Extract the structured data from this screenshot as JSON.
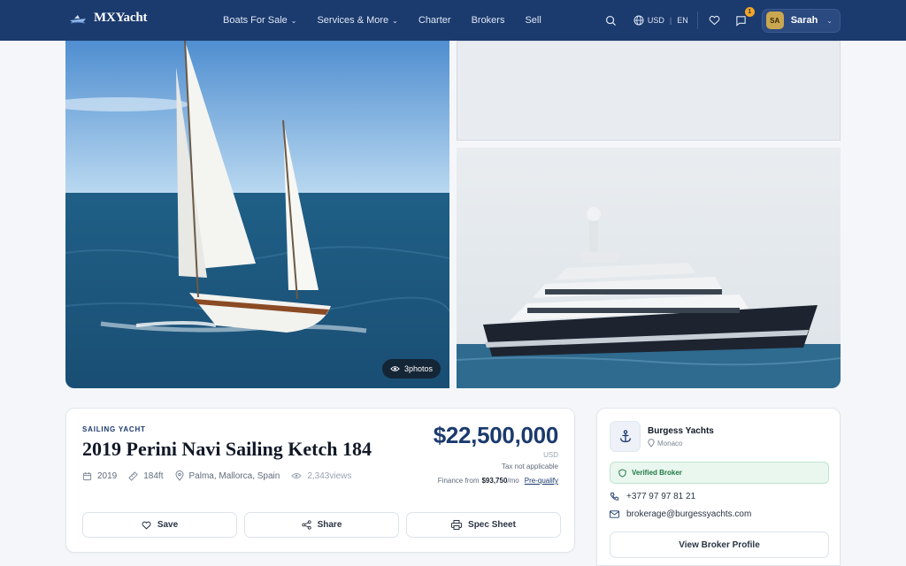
{
  "nav": {
    "logo_text": "MXYacht",
    "menu": [
      {
        "label": "Boats For Sale",
        "has_dropdown": true
      },
      {
        "label": "Services & More",
        "has_dropdown": true
      },
      {
        "label": "Charter",
        "has_dropdown": false
      },
      {
        "label": "Brokers",
        "has_dropdown": false
      },
      {
        "label": "Sell",
        "has_dropdown": false
      }
    ],
    "currency": "USD",
    "language": "EN",
    "messages_badge": "1",
    "user": {
      "initials": "SA",
      "name": "Sarah"
    },
    "icons": [
      "search-icon",
      "globe-icon",
      "heart-icon",
      "chat-icon",
      "chevron-down-icon"
    ],
    "colors": {
      "nav_bg": "#1b3a6d",
      "badge": "#f5a623",
      "avatar": "#c9a64f"
    }
  },
  "gallery": {
    "photo_count": "3photos"
  },
  "listing": {
    "category": "SAILING YACHT",
    "title": "2019 Perini Navi Sailing Ketch 184",
    "year": "2019",
    "length": "184ft",
    "location": "Palma, Mallorca, Spain",
    "views": "2,343views",
    "price": "$22,500,000",
    "currency": "USD",
    "tax_note": "Tax not applicable",
    "finance_prefix": "Finance from",
    "finance_amount": "$93,750",
    "finance_suffix": "/mo",
    "prequalify": "Pre-qualify",
    "actions": {
      "save": "Save",
      "share": "Share",
      "spec_sheet": "Spec Sheet"
    },
    "accent_color": "#1b3a6d"
  },
  "broker": {
    "name": "Burgess Yachts",
    "location": "Monaco",
    "verified": "Verified Broker",
    "phone": "+377 97 97 81 21",
    "email": "brokerage@burgessyachts.com",
    "view_profile": "View Broker Profile",
    "verified_color": "#1f7a45"
  }
}
